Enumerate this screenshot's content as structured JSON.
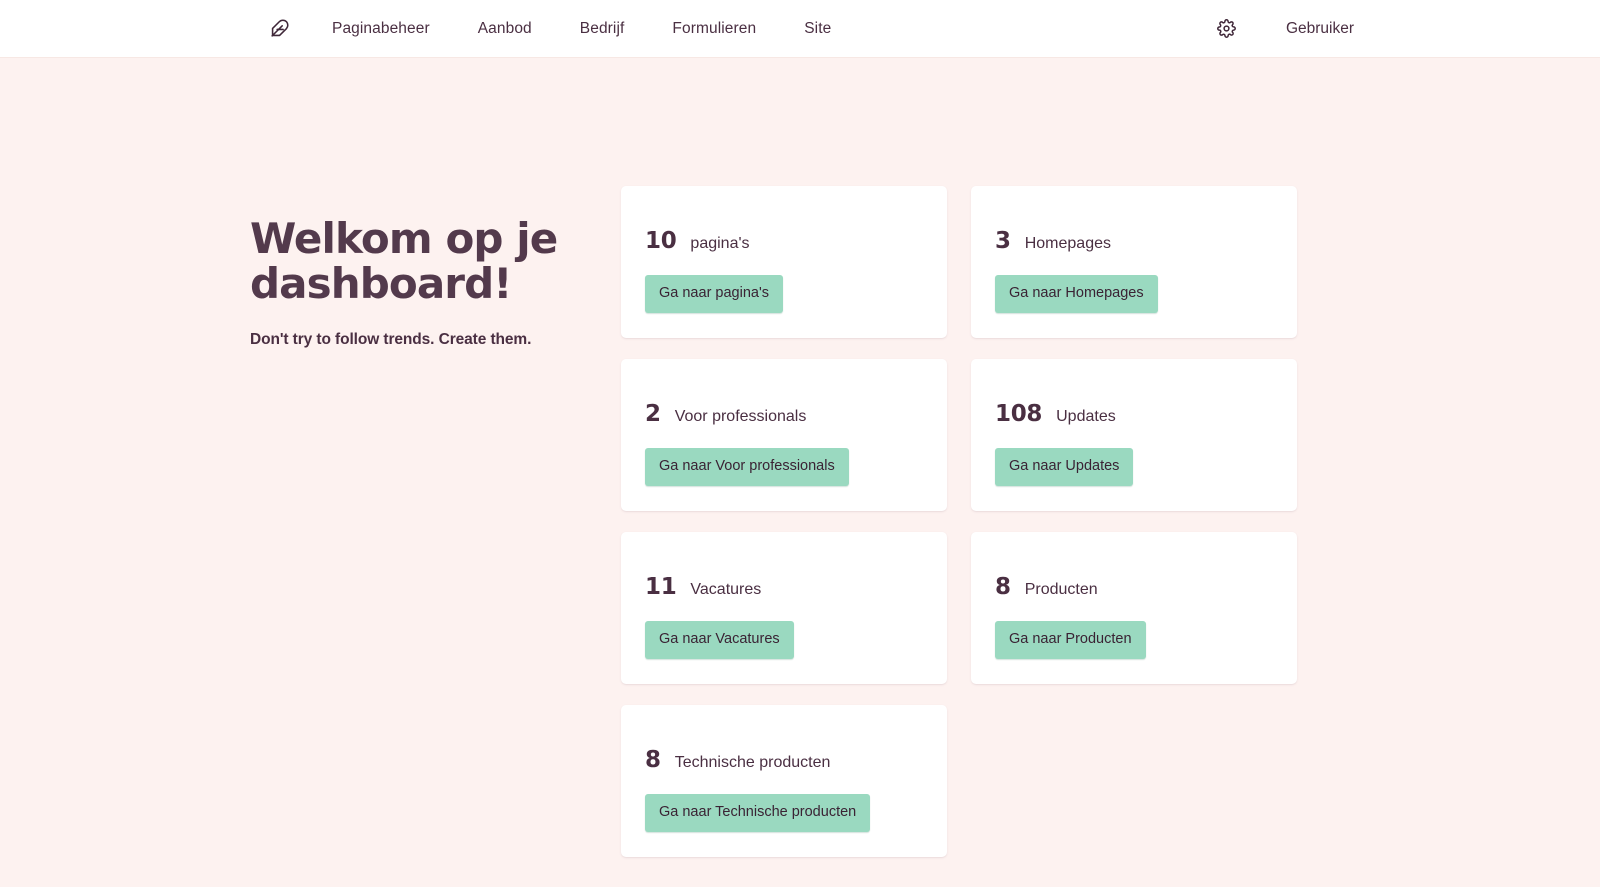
{
  "topbar": {
    "logo_icon": "feather-icon",
    "nav_items": [
      {
        "label": "Paginabeheer"
      },
      {
        "label": "Aanbod"
      },
      {
        "label": "Bedrijf"
      },
      {
        "label": "Formulieren"
      },
      {
        "label": "Site"
      }
    ],
    "settings_icon": "gear-icon",
    "user_label": "Gebruiker"
  },
  "welcome": {
    "title": "Welkom op je dashboard!",
    "subtitle": "Don't try to follow trends. Create them."
  },
  "cards": [
    {
      "count": "10",
      "label": "pagina's",
      "button": "Ga naar pagina's"
    },
    {
      "count": "3",
      "label": "Homepages",
      "button": "Ga naar Homepages"
    },
    {
      "count": "2",
      "label": "Voor professionals",
      "button": "Ga naar Voor professionals"
    },
    {
      "count": "108",
      "label": "Updates",
      "button": "Ga naar Updates"
    },
    {
      "count": "11",
      "label": "Vacatures",
      "button": "Ga naar Vacatures"
    },
    {
      "count": "8",
      "label": "Producten",
      "button": "Ga naar Producten"
    },
    {
      "count": "8",
      "label": "Technische producten",
      "button": "Ga naar Technische producten"
    }
  ],
  "colors": {
    "page_background": "#fdf2f0",
    "card_background": "#ffffff",
    "text": "#4a2f42",
    "button": "#9ad9c0"
  }
}
